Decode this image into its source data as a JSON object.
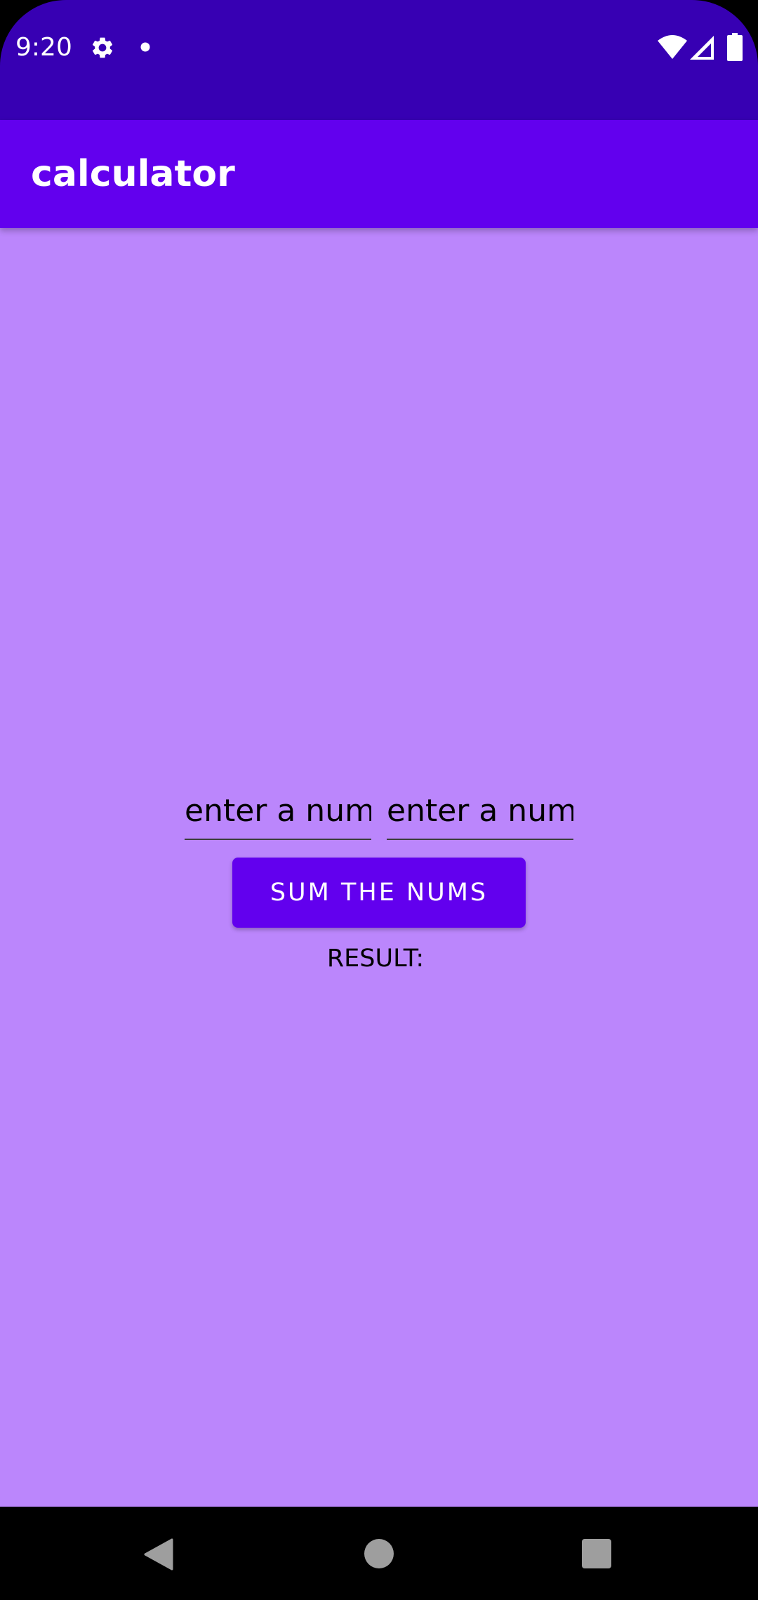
{
  "status_bar": {
    "time": "9:20",
    "icons": [
      "gear-icon",
      "notification-dot-icon",
      "wifi-icon",
      "cellular-signal-icon",
      "battery-icon"
    ],
    "background_color": "#3700b3"
  },
  "app_bar": {
    "title": "calculator",
    "background_color": "#6200ee"
  },
  "form": {
    "first_number": {
      "value": "",
      "placeholder": "enter a num"
    },
    "second_number": {
      "value": "",
      "placeholder": "enter a num"
    },
    "sum_button_label": "SUM THE NUMS",
    "result_label": "RESULT:"
  },
  "content": {
    "background_color": "#bb86fc"
  },
  "nav_bar": {
    "buttons": [
      "back-icon",
      "home-icon",
      "recents-icon"
    ],
    "background_color": "#000000"
  }
}
